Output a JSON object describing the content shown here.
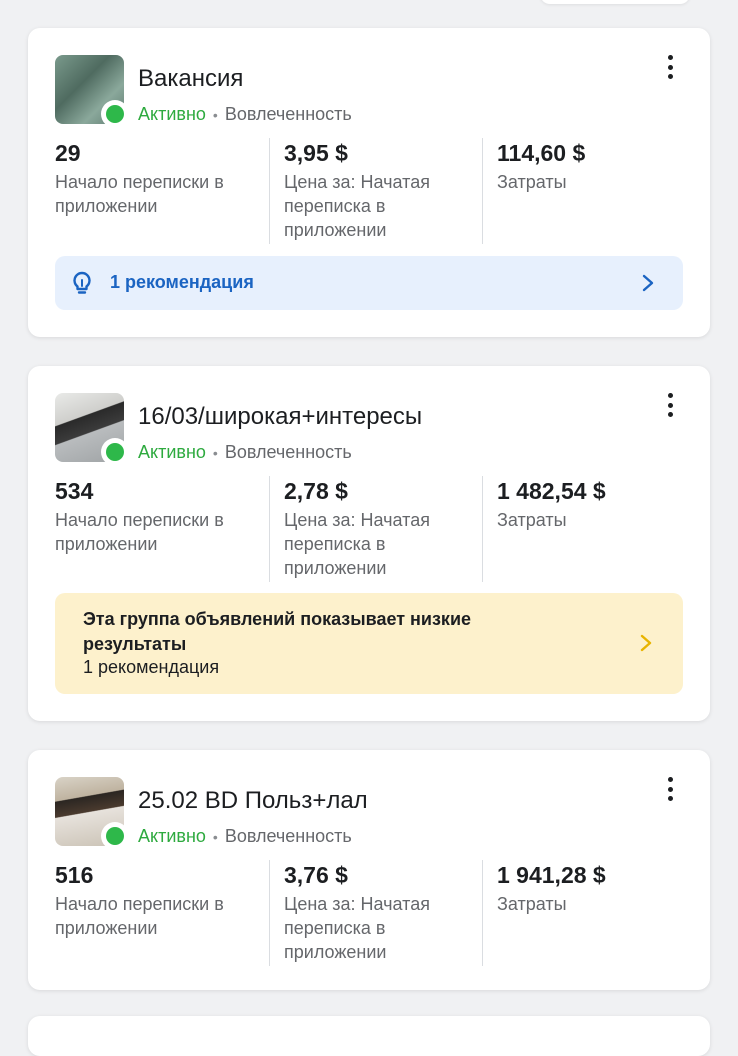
{
  "campaigns": [
    {
      "title": "Вакансия",
      "status": "Активно",
      "separator": "•",
      "objective": "Вовлеченность",
      "thumbnail_icon": "ad-thumbnail",
      "metrics": [
        {
          "value": "29",
          "label": "Начало переписки в приложении"
        },
        {
          "value": "3,95 $",
          "label": "Цена за: Начатая переписка в приложении"
        },
        {
          "value": "114,60 $",
          "label": "Затраты"
        }
      ],
      "recommendation": {
        "text": "1 рекомендация",
        "icon": "lightbulb-icon"
      }
    },
    {
      "title": "16/03/широкая+интересы",
      "status": "Активно",
      "separator": "•",
      "objective": "Вовлеченность",
      "thumbnail_icon": "ad-thumbnail",
      "metrics": [
        {
          "value": "534",
          "label": "Начало переписки в приложении"
        },
        {
          "value": "2,78 $",
          "label": "Цена за: Начатая переписка в приложении"
        },
        {
          "value": "1 482,54 $",
          "label": "Затраты"
        }
      ],
      "warning": {
        "heading": "Эта группа объявлений показывает низкие результаты",
        "count": "1 рекомендация"
      }
    },
    {
      "title": "25.02 BD Польз+лал",
      "status": "Активно",
      "separator": "•",
      "objective": "Вовлеченность",
      "thumbnail_icon": "ad-thumbnail",
      "metrics": [
        {
          "value": "516",
          "label": "Начало переписки в приложении"
        },
        {
          "value": "3,76 $",
          "label": "Цена за: Начатая переписка в приложении"
        },
        {
          "value": "1 941,28 $",
          "label": "Затраты"
        }
      ]
    }
  ],
  "colors": {
    "active_green": "#2eaa3f",
    "status_dot": "#2eb84a",
    "recommendation_bg": "#e7f0fd",
    "recommendation_text": "#1b64c2",
    "warning_bg": "#fdf1cc",
    "warning_chevron": "#e8b400"
  }
}
